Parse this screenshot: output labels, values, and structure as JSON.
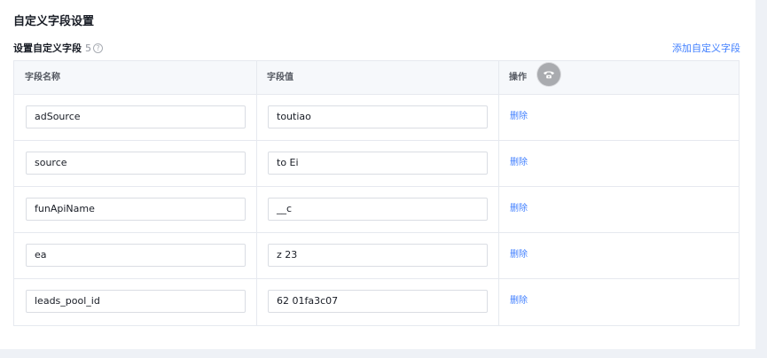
{
  "page": {
    "title": "自定义字段设置"
  },
  "section": {
    "title": "设置自定义字段",
    "count": "5",
    "help_icon": "question-circle-icon",
    "add_link": "添加自定义字段"
  },
  "table": {
    "headers": {
      "name": "字段名称",
      "value": "字段值",
      "action": "操作"
    },
    "rows": [
      {
        "name": "adSource",
        "value": "toutiao",
        "action": "删除"
      },
      {
        "name": "source",
        "value": "to        Ei",
        "action": "删除"
      },
      {
        "name": "funApiName",
        "value": "                 __c",
        "action": "删除"
      },
      {
        "name": "ea",
        "value": "z               23",
        "action": "删除"
      },
      {
        "name": "leads_pool_id",
        "value": "62                                01fa3c07",
        "action": "删除"
      }
    ]
  },
  "floating_button": {
    "icon": "phone-icon"
  },
  "colors": {
    "link": "#407fff",
    "header_bg": "#f6f8fb",
    "border": "#e6e9ef",
    "page_bg": "#eef1f6"
  }
}
